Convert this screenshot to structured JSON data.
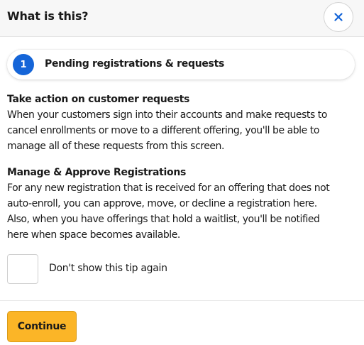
{
  "header": {
    "title": "What is this?",
    "close_icon": "close-icon",
    "close_color": "#1565d8"
  },
  "step": {
    "number": "1",
    "label": "Pending registrations & requests",
    "badge_color": "#1565d8"
  },
  "sections": [
    {
      "heading": "Take action on customer requests",
      "lines": [
        "When your customers sign into their accounts and make requests to",
        "cancel enrollments or move to a different offering, you'll be able to",
        "manage all of these requests from this screen."
      ]
    },
    {
      "heading": "Manage & Approve Registrations",
      "lines": [
        "For any new registration that is received for an offering that does not",
        "auto-enroll, you can approve, move, or decline a registration here.",
        "Also, when you have offerings that hold a waitlist, you'll be notified",
        "here when space becomes available."
      ]
    }
  ],
  "tip": {
    "label": "Don't show this tip again",
    "checked": false
  },
  "footer": {
    "continue_label": "Continue",
    "button_color": "#fbb527"
  }
}
